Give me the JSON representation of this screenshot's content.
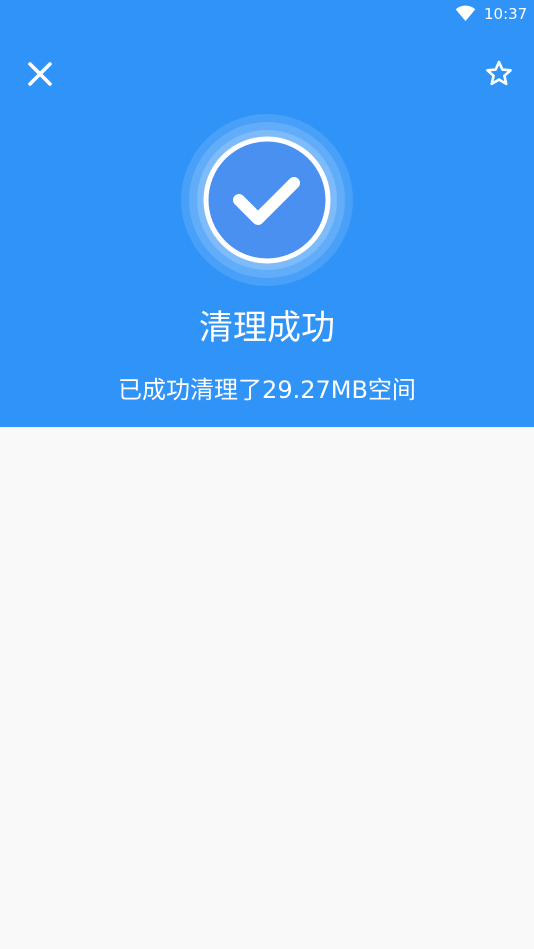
{
  "status_bar": {
    "time": "10:37",
    "wifi_icon": "wifi-icon"
  },
  "toolbar": {
    "close_icon": "close-icon",
    "favorite_icon": "star-outline-icon"
  },
  "result": {
    "badge_icon": "checkmark-circle-icon",
    "title": "清理成功",
    "subtitle": "已成功清理了29.27MB空间"
  },
  "colors": {
    "header_background": "#2f93f8",
    "badge_fill": "#4a90f0",
    "page_background": "#f9f9f9"
  }
}
